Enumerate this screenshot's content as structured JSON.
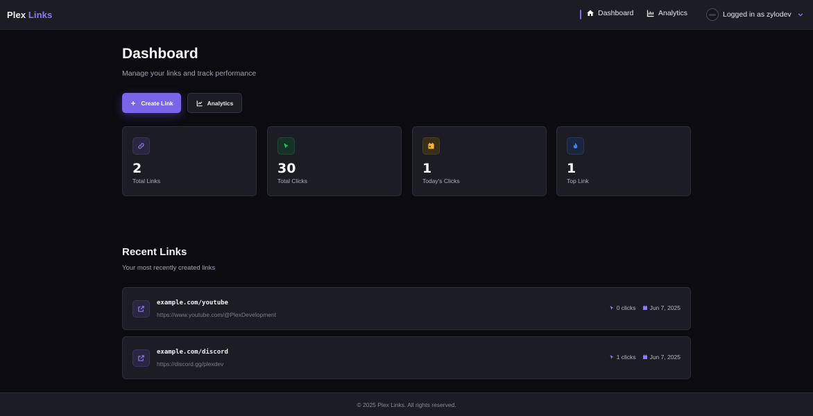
{
  "header": {
    "brand_part1": "Plex",
    "brand_part2": "Links",
    "nav": [
      {
        "label": "Dashboard",
        "icon": "home-icon"
      },
      {
        "label": "Analytics",
        "icon": "chart-icon"
      }
    ],
    "user_label": "Logged in as zylodev"
  },
  "main": {
    "title": "Dashboard",
    "subtitle": "Manage your links and track performance",
    "create_button": "Create Link",
    "analytics_button": "Analytics",
    "stats": [
      {
        "value": "2",
        "label": "Total Links",
        "icon": "link-icon",
        "color": "#8b7cf6",
        "bg": "#2a2540"
      },
      {
        "value": "30",
        "label": "Total Clicks",
        "icon": "cursor-icon",
        "color": "#22c55e",
        "bg": "#163226"
      },
      {
        "value": "1",
        "label": "Today's Clicks",
        "icon": "calendar-icon",
        "color": "#f5b82e",
        "bg": "#3a2e16"
      },
      {
        "value": "1",
        "label": "Top Link",
        "icon": "fire-icon",
        "color": "#3b82f6",
        "bg": "#1a2540"
      }
    ],
    "recent": {
      "title": "Recent Links",
      "subtitle": "Your most recently created links",
      "links": [
        {
          "short": "example.com/youtube",
          "target": "https://www.youtube.com/@PlexDevelopment",
          "clicks": "0 clicks",
          "date": "Jun 7, 2025"
        },
        {
          "short": "example.com/discord",
          "target": "https://discord.gg/plexdev",
          "clicks": "1 clicks",
          "date": "Jun 7, 2025"
        }
      ]
    }
  },
  "footer": {
    "text": "© 2025 Plex Links. All rights reserved."
  },
  "colors": {
    "accent": "#7a64e8",
    "background": "#0b0b10",
    "card": "#1c1c24"
  }
}
